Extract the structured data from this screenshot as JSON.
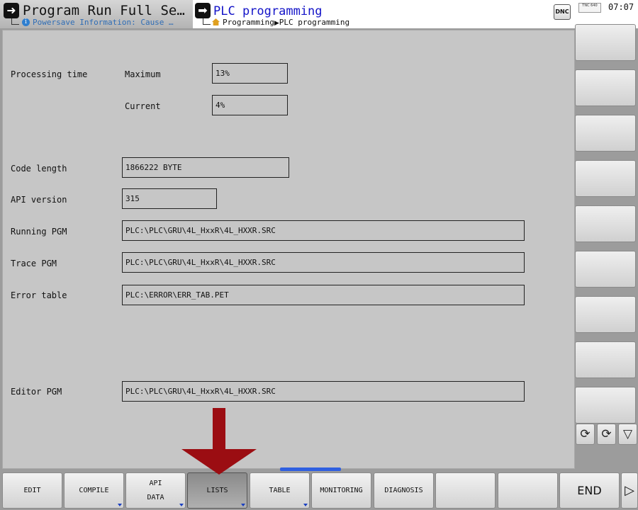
{
  "header": {
    "left_mode": {
      "title": "Program Run Full Se…",
      "subtitle": "Powersave Information: Cause …",
      "icon": "program-run-icon"
    },
    "right_mode": {
      "title": "PLC programming",
      "breadcrumb_1": "Programming",
      "breadcrumb_2": "PLC programming",
      "icon": "programming-mode-icon"
    },
    "dnc_label": "DNC",
    "tnc_logo": "TNC 640",
    "clock": "07:07"
  },
  "main": {
    "processing_time_label": "Processing time",
    "maximum_label": "Maximum",
    "maximum_value": "13%",
    "current_label": "Current",
    "current_value": "4%",
    "code_length_label": "Code length",
    "code_length_value": "1866222 BYTE",
    "api_version_label": "API version",
    "api_version_value": "315",
    "running_pgm_label": "Running PGM",
    "running_pgm_value": "PLC:\\PLC\\GRU\\4L_HxxR\\4L_HXXR.SRC",
    "trace_pgm_label": "Trace PGM",
    "trace_pgm_value": "PLC:\\PLC\\GRU\\4L_HxxR\\4L_HXXR.SRC",
    "error_table_label": "Error table",
    "error_table_value": "PLC:\\ERROR\\ERR_TAB.PET",
    "editor_pgm_label": "Editor PGM",
    "editor_pgm_value": "PLC:\\PLC\\GRU\\4L_HxxR\\4L_HXXR.SRC"
  },
  "softkeys": {
    "edit": "EDIT",
    "compile": "COMPILE",
    "api_data_line1": "API",
    "api_data_line2": "DATA",
    "lists": "LISTS",
    "table": "TABLE",
    "monitoring": "MONITORING",
    "diagnosis": "DIAGNOSIS",
    "end": "END"
  },
  "colors": {
    "panel": "#c6c6c6",
    "title_blue": "#1414c8",
    "annotation_red": "#9b0d12",
    "active_indicator": "#2f5fe0"
  }
}
